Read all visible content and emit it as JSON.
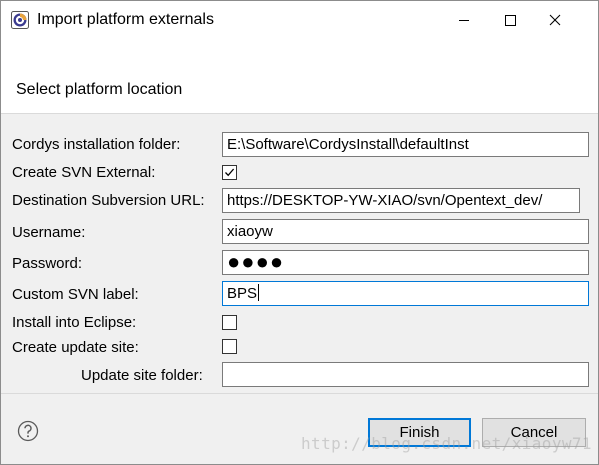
{
  "window": {
    "title": "Import platform externals"
  },
  "header": {
    "title": "Select platform location"
  },
  "form": {
    "installation_folder": {
      "label": "Cordys installation folder:",
      "value": "E:\\Software\\CordysInstall\\defaultInst"
    },
    "create_svn_external": {
      "label": "Create SVN External:",
      "checked": true
    },
    "destination_url": {
      "label": "Destination Subversion URL:",
      "value": "https://DESKTOP-YW-XIAO/svn/Opentext_dev/"
    },
    "username": {
      "label": "Username:",
      "value": "xiaoyw"
    },
    "password": {
      "label": "Password:",
      "masked_value": "●●●●"
    },
    "custom_svn_label": {
      "label": "Custom SVN label:",
      "value": "BPS"
    },
    "install_into_eclipse": {
      "label": "Install into Eclipse:",
      "checked": false
    },
    "create_update_site": {
      "label": "Create update site:",
      "checked": false
    },
    "update_site_folder": {
      "label": "Update site folder:",
      "value": ""
    }
  },
  "buttons": {
    "finish": "Finish",
    "cancel": "Cancel"
  },
  "icons": {
    "app": "eclipse-icon",
    "help": "help-icon",
    "minimize": "minimize-icon",
    "maximize": "maximize-icon",
    "close": "close-icon",
    "checkmark": "checkmark-icon"
  },
  "colors": {
    "focus_accent": "#0078d7",
    "button_face": "#e1e1e1",
    "dialog_background": "#f0f0f0"
  },
  "watermark": "http://blog.csdn.net/xiaoyw71"
}
